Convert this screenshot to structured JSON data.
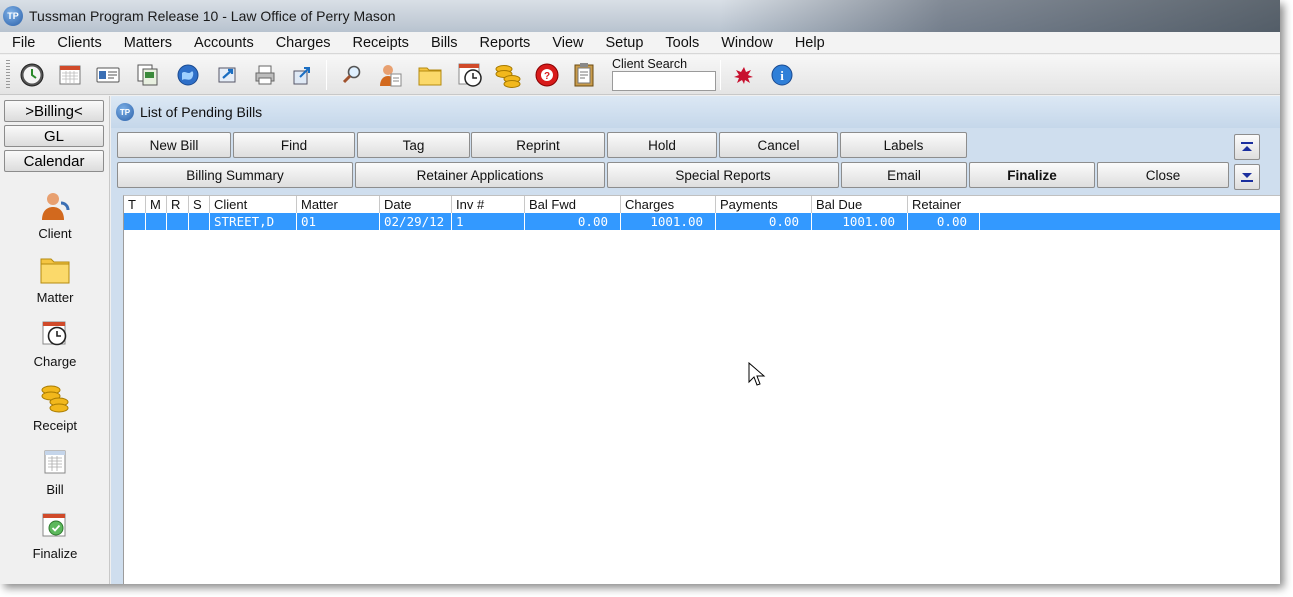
{
  "window": {
    "title": "Tussman Program Release 10 - Law Office of Perry Mason",
    "icon_text": "TP"
  },
  "menu": [
    "File",
    "Clients",
    "Matters",
    "Accounts",
    "Charges",
    "Receipts",
    "Bills",
    "Reports",
    "View",
    "Setup",
    "Tools",
    "Window",
    "Help"
  ],
  "toolbar": {
    "client_search_label": "Client Search",
    "client_search_value": "",
    "icons": [
      "clock-icon",
      "calendar-icon",
      "contact-card-icon",
      "documents-icon",
      "globe-icon",
      "transfer-icon",
      "printer-icon",
      "export-icon",
      "search-icon",
      "client-icon",
      "folder-icon",
      "charge-timer-icon",
      "coins-icon",
      "help-icon",
      "clipboard-icon",
      "bug-icon",
      "info-icon"
    ]
  },
  "sidebar": {
    "nav": [
      {
        "label": ">Billing<"
      },
      {
        "label": "GL"
      },
      {
        "label": "Calendar"
      }
    ],
    "items": [
      {
        "label": "Client",
        "icon": "client-icon"
      },
      {
        "label": "Matter",
        "icon": "folder-icon"
      },
      {
        "label": "Charge",
        "icon": "charge-timer-icon"
      },
      {
        "label": "Receipt",
        "icon": "coins-icon"
      },
      {
        "label": "Bill",
        "icon": "bill-icon"
      },
      {
        "label": "Finalize",
        "icon": "finalize-icon"
      }
    ]
  },
  "child": {
    "title": "List of Pending Bills",
    "row1_buttons": [
      "New Bill",
      "Find",
      "Tag",
      "Reprint",
      "Hold",
      "Cancel",
      "Labels"
    ],
    "row2_buttons": [
      "Billing Summary",
      "Retainer Applications",
      "Special Reports",
      "Email",
      "Finalize",
      "Close"
    ]
  },
  "grid": {
    "columns": [
      "T",
      "M",
      "R",
      "S",
      "Client",
      "Matter",
      "Date",
      "Inv #",
      "Bal Fwd",
      "Charges",
      "Payments",
      "Bal Due",
      "Retainer"
    ],
    "rows": [
      [
        "",
        "",
        "",
        "",
        "STREET,D",
        "01",
        "02/29/12",
        "1",
        "0.00",
        "1001.00",
        "0.00",
        "1001.00",
        "0.00"
      ]
    ]
  },
  "colors": {
    "selection": "#3399ff",
    "child_background": "#cfdeee"
  }
}
